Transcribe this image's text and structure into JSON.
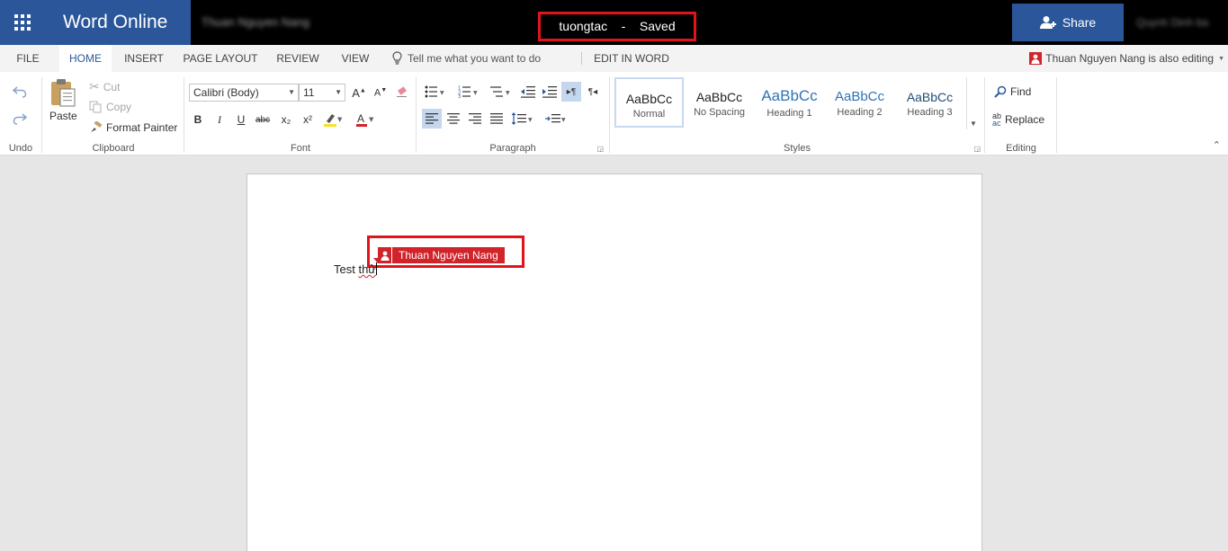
{
  "app": {
    "name": "Word Online",
    "user_name": "Thuan Nguyen Nang",
    "top_right_name": "Quynh Dinh ba"
  },
  "document": {
    "title": "tuongtac",
    "separator": "-",
    "status": "Saved",
    "body_text_pre": "Test ",
    "body_text_word": "thử"
  },
  "share": {
    "label": "Share"
  },
  "tabs": [
    {
      "label": "FILE",
      "active": false
    },
    {
      "label": "HOME",
      "active": true
    },
    {
      "label": "INSERT",
      "active": false
    },
    {
      "label": "PAGE LAYOUT",
      "active": false
    },
    {
      "label": "REVIEW",
      "active": false
    },
    {
      "label": "VIEW",
      "active": false
    }
  ],
  "tell_me": {
    "placeholder": "Tell me what you want to do"
  },
  "edit_in_word": {
    "label": "EDIT IN WORD"
  },
  "coauthor_notice": {
    "label": "Thuan Nguyen Nang is also editing"
  },
  "ribbon": {
    "undo_group": {
      "label": "Undo"
    },
    "clipboard": {
      "label": "Clipboard",
      "paste": "Paste",
      "cut": "Cut",
      "copy": "Copy",
      "format_painter": "Format Painter"
    },
    "font": {
      "label": "Font",
      "family": "Calibri (Body)",
      "size": "11",
      "bold": "B",
      "italic": "I",
      "underline": "U",
      "strikethrough": "abc",
      "subscript": "x₂",
      "superscript": "x²"
    },
    "paragraph": {
      "label": "Paragraph"
    },
    "styles": {
      "label": "Styles",
      "items": [
        {
          "sample": "AaBbCc",
          "name": "Normal",
          "color": "#222222"
        },
        {
          "sample": "AaBbCc",
          "name": "No Spacing",
          "color": "#222222"
        },
        {
          "sample": "AaBbCc",
          "name": "Heading 1",
          "color": "#2e74b5"
        },
        {
          "sample": "AaBbCc",
          "name": "Heading 2",
          "color": "#2e74b5"
        },
        {
          "sample": "AaBbCc",
          "name": "Heading 3",
          "color": "#1f4d78"
        }
      ]
    },
    "editing": {
      "label": "Editing",
      "find": "Find",
      "replace": "Replace"
    }
  },
  "coauthor_flag": {
    "name": "Thuan Nguyen Nang"
  },
  "colors": {
    "brand": "#2b579a",
    "topbar": "#000000",
    "highlight_box": "#e1141c",
    "coauthor": "#d0232a"
  }
}
